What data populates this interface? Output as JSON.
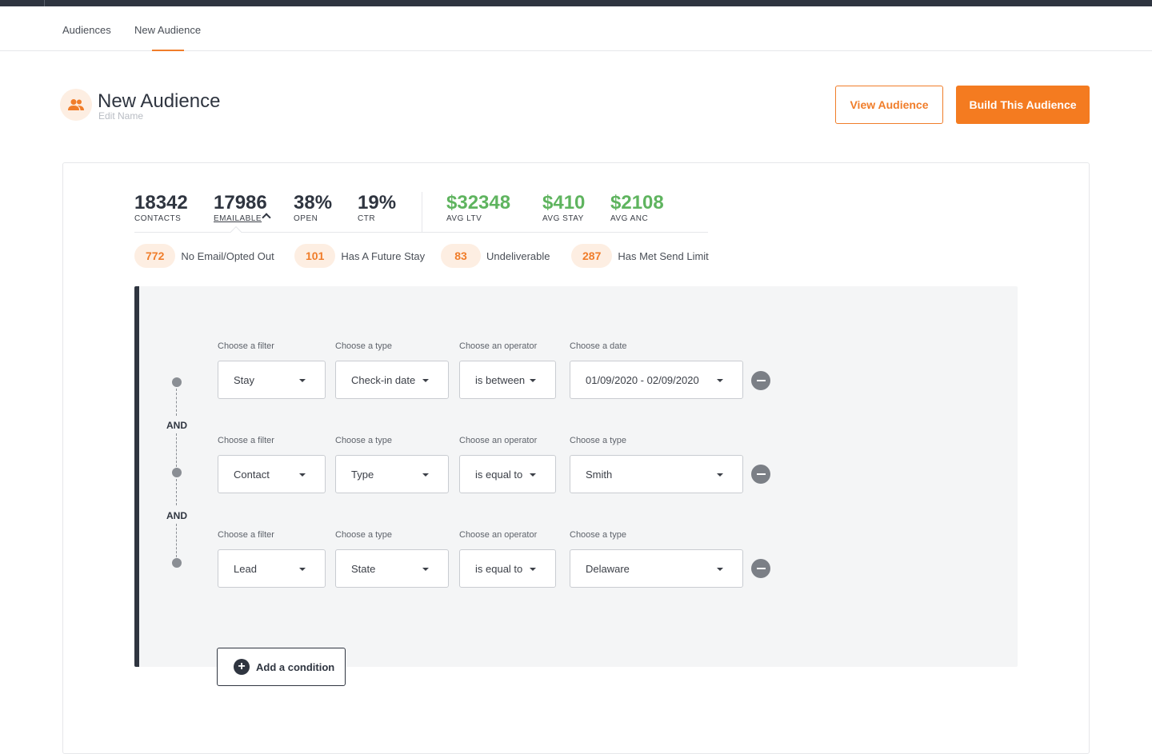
{
  "nav": {
    "tabs": [
      "Audiences",
      "New Audience"
    ]
  },
  "header": {
    "title": "New Audience",
    "edit_name": "Edit Name",
    "icon": "users-icon",
    "view_button": "View Audience",
    "build_button": "Build This Audience"
  },
  "colors": {
    "accent": "#f47b20",
    "accent_light": "#fdeee2",
    "positive": "#5fb45f",
    "dark": "#2f3540"
  },
  "stats": [
    {
      "value": "18342",
      "label": "CONTACTS"
    },
    {
      "value": "17986",
      "label": "EMAILABLE"
    },
    {
      "value": "38%",
      "label": "OPEN"
    },
    {
      "value": "19%",
      "label": "CTR"
    },
    {
      "value": "$32348",
      "label": "AVG LTV"
    },
    {
      "value": "$410",
      "label": "AVG STAY"
    },
    {
      "value": "$2108",
      "label": "AVG ANC"
    }
  ],
  "breakdown": [
    {
      "count": "772",
      "label": "No Email/Opted Out"
    },
    {
      "count": "101",
      "label": "Has A Future Stay"
    },
    {
      "count": "83",
      "label": "Undeliverable"
    },
    {
      "count": "287",
      "label": "Has Met Send Limit"
    }
  ],
  "connector": "AND",
  "conditions": [
    {
      "filter_label": "Choose a filter",
      "filter": "Stay",
      "type_label": "Choose a type",
      "type": "Check-in date",
      "operator_label": "Choose an operator",
      "operator": "is between",
      "value_label": "Choose a date",
      "value": "01/09/2020 - 02/09/2020"
    },
    {
      "filter_label": "Choose a filter",
      "filter": "Contact",
      "type_label": "Choose a type",
      "type": "Type",
      "operator_label": "Choose an operator",
      "operator": "is equal to",
      "value_label": "Choose a type",
      "value": "Smith"
    },
    {
      "filter_label": "Choose a filter",
      "filter": "Lead",
      "type_label": "Choose a type",
      "type": "State",
      "operator_label": "Choose an operator",
      "operator": "is equal to",
      "value_label": "Choose a type",
      "value": "Delaware"
    }
  ],
  "add_condition": "Add a condition"
}
